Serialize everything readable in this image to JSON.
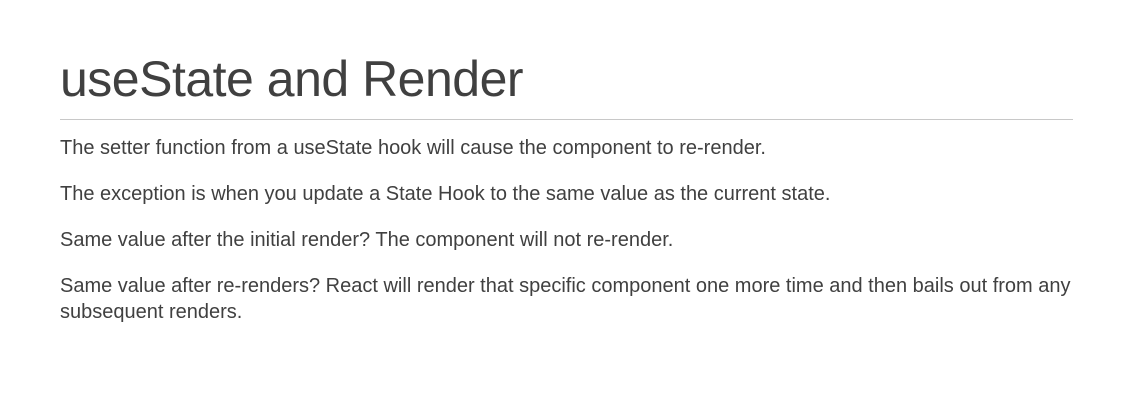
{
  "slide": {
    "title": "useState and Render",
    "paragraphs": [
      "The setter function from a useState hook will cause the component to re-render.",
      "The exception is when you update a State Hook to the same value as the current state.",
      "Same value after the initial render? The component will not re-render.",
      "Same value after re-renders? React will render that specific component one more time and then bails out from any subsequent renders."
    ]
  }
}
